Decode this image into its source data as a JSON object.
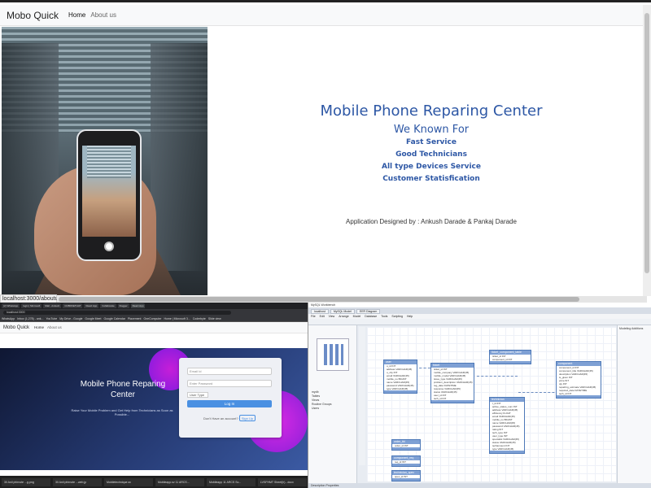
{
  "top": {
    "brand": "Mobo Quick",
    "nav": [
      {
        "label": "Home"
      },
      {
        "label": "About us"
      }
    ],
    "about": {
      "title": "Mobile Phone Reparing Center",
      "subtitle": "We Known For",
      "items": [
        "Fast Service",
        "Good Technicians",
        "All type Devices Service",
        "Customer Statisfication"
      ],
      "credits": "Application Designed by : Ankush Darade & Pankaj Darade"
    },
    "status_url": "localhost:3000/aboutus"
  },
  "browser": {
    "url": "localhost:3000",
    "tabs": [
      "(2) WhatsApp",
      "login | Microsoft",
      "Mail - Ankush",
      "CCBDKETHAT",
      "React App",
      "Collaborate",
      "blogger",
      "React App"
    ],
    "bookmarks": [
      "WhatsApp",
      "Inbox (1,278) - ank...",
      "YouTube",
      "My Drive - Google",
      "Google Meet",
      "Google Calendar",
      "Placement",
      "OneComputer",
      "Home | Microsoft 3...",
      "Coderbyte",
      "Slide view"
    ],
    "brand": "Mobo Quick",
    "nav": [
      "Home",
      "About us"
    ],
    "hero_title": "Mobile Phone Reparing Center",
    "hero_sub": "Raise Your Mobile Problem and Get Help from Technicians as Soon as Possible...",
    "login": {
      "email_placeholder": "Email Id",
      "password_placeholder": "Enter Password",
      "user_type": "User Type",
      "button": "Log In",
      "question": "Don't Have an account?",
      "signup": "Sign Up"
    },
    "taskbar": [
      "30 Anil phirnote ...g.png",
      "30 Anil phirnote ...web.jp",
      "Mobiletechnique.sv",
      "Mobileapp.sv 11 ARCS...",
      "Mobileapp 11 ARCS Sc...",
      "LVSFHMT Sheet(h)...docx"
    ]
  },
  "workbench": {
    "title": "MySQL Workbench",
    "tabs": [
      "localhost",
      "MySQL Model",
      "EER Diagram"
    ],
    "menu": [
      "File",
      "Edit",
      "View",
      "Arrange",
      "Model",
      "Database",
      "Tools",
      "Scripting",
      "Help"
    ],
    "canvas_label": "Diagram",
    "tree_items": [
      "mydb",
      "Tables",
      "Views",
      "Routine Groups",
      "Users"
    ],
    "right_panel": [
      "Modeling Additions"
    ],
    "bottom_tabs": "Description  Properties",
    "tables": [
      {
        "name": "user",
        "rows": [
          "u_id INT",
          "address VARCHAR(45)",
          "u_city INT",
          "email VARCHAR(45)",
          "mobile_no BIGINT",
          "name VARCHAR(45)",
          "password VARCHAR(45)",
          "type VARCHAR(45)"
        ]
      },
      {
        "name": "ticket",
        "rows": [
          "ticket_id INT",
          "mobile_company VARCHAR(45)",
          "mobile_model VARCHAR(45)",
          "issue_type VARCHAR(45)",
          "problem_description VARCHAR(45)",
          "reg_date DATETIME",
          "response VARCHAR(45)",
          "status VARCHAR(45)",
          "user_id INT",
          "tech_id INT"
        ]
      },
      {
        "name": "ticket_component_table",
        "rows": [
          "ticket_id INT",
          "component_id INT"
        ]
      },
      {
        "name": "component",
        "rows": [
          "component_id INT",
          "component_title VARCHAR(45)",
          "description VARCHAR(45)",
          "is_given INT",
          "price INT",
          "qty INT",
          "repairing_estimate VARCHAR(45)",
          "required_date DATETIME",
          "tech_id INT"
        ]
      },
      {
        "name": "technician",
        "rows": [
          "t_id INT",
          "active_status_num INT",
          "address VARCHAR(45)",
          "efficiency FLOAT",
          "email VARCHAR(45)",
          "mobile_no BIGINT",
          "name VARCHAR(45)",
          "password VARCHAR(45)",
          "rating INT",
          "tech_type INT",
          "user_type INT",
          "specialist VARCHAR(45)",
          "status VARCHAR(45)",
          "techamount INT",
          "type VARCHAR(45)"
        ]
      },
      {
        "name": "order_tbl",
        "rows": [
          "order_id INT"
        ]
      },
      {
        "name": "component_req",
        "rows": [
          "req_id INT"
        ]
      },
      {
        "name": "technician_spec",
        "rows": [
          "spec_id INT"
        ]
      }
    ]
  }
}
